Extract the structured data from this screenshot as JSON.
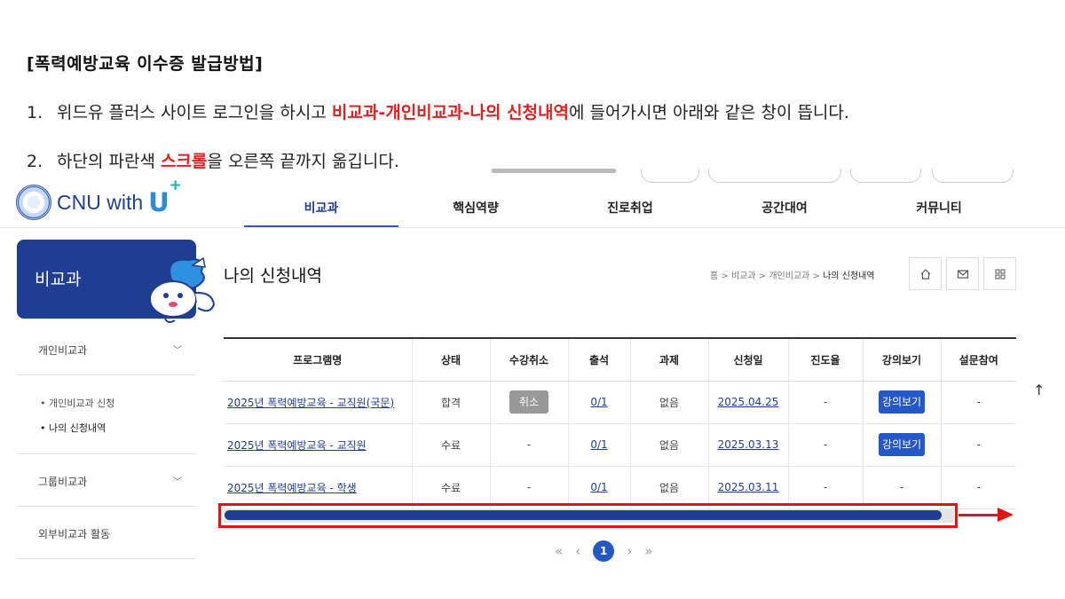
{
  "instructions": {
    "title": "[폭력예방교육 이수증 발급방법]",
    "step1": {
      "num": "1.",
      "before": "위드유 플러스 사이트 로그인을 하시고 ",
      "highlight": "비교과-개인비교과-나의 신청내역",
      "after": "에 들어가시면 아래와 같은 창이 뜹니다."
    },
    "step2": {
      "num": "2.",
      "before": "하단의 파란색 ",
      "highlight": "스크롤",
      "after": "을 오른쪽 끝까지 옮깁니다."
    }
  },
  "site": {
    "logo_text": "CNU with",
    "logo_u": "U",
    "logo_plus": "+",
    "nav": [
      "비교과",
      "핵심역량",
      "진로취업",
      "공간대여",
      "커뮤니티"
    ]
  },
  "sidebar": {
    "title": "비교과",
    "items": [
      {
        "label": "개인비교과",
        "chevron": "﹀"
      },
      {
        "label": "그룹비교과",
        "chevron": "﹀"
      },
      {
        "label": "외부비교과 활동"
      }
    ],
    "sub": [
      "• 개인비교과 신청",
      "• 나의 신청내역"
    ]
  },
  "content": {
    "title": "나의 신청내역",
    "breadcrumb": {
      "home": "홈",
      "sep": ">",
      "c1": "비교과",
      "c2": "개인비교과",
      "current": "나의 신청내역"
    },
    "columns": [
      "프로그램명",
      "상태",
      "수강취소",
      "출석",
      "과제",
      "신청일",
      "진도율",
      "강의보기",
      "설문참여"
    ],
    "rows": [
      {
        "program": "2025년 폭력예방교육 - 교직원(국문)",
        "status": "합격",
        "cancel": "취소",
        "attendance": "0/1",
        "assignment": "없음",
        "date": "2025.04.25",
        "progress": "-",
        "lecture": "강의보기",
        "survey": "-"
      },
      {
        "program": "2025년 폭력예방교육 - 교직원",
        "status": "수료",
        "cancel": "-",
        "attendance": "0/1",
        "assignment": "없음",
        "date": "2025.03.13",
        "progress": "-",
        "lecture": "강의보기",
        "survey": "-"
      },
      {
        "program": "2025년 폭력예방교육 - 학생",
        "status": "수료",
        "cancel": "-",
        "attendance": "0/1",
        "assignment": "없음",
        "date": "2025.03.11",
        "progress": "-",
        "lecture": "-",
        "survey": "-"
      }
    ],
    "pager": {
      "first": "«",
      "prev": "‹",
      "current": "1",
      "next": "›",
      "last": "»"
    },
    "top_icon": "↑"
  },
  "colors": {
    "accent": "#1f3d92",
    "highlight_red": "#e41f1f",
    "button_blue": "#2458c9"
  }
}
